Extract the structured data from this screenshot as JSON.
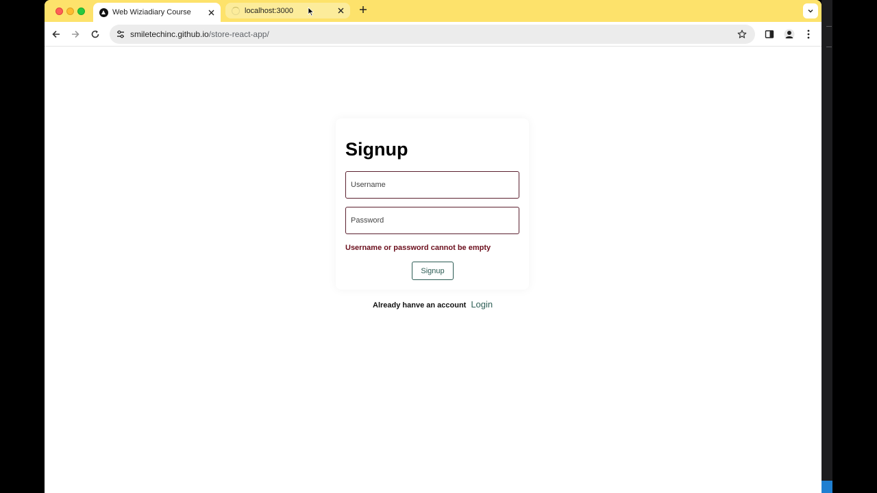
{
  "browser": {
    "tabs": [
      {
        "title": "Web Wiziadiary Course",
        "active": true,
        "favicon": "triangle-logo-icon"
      },
      {
        "title": "localhost:3000",
        "active": false,
        "favicon": "loading-spinner-icon"
      }
    ],
    "address": {
      "host": "smiletechinc.github.io",
      "path": "/store-react-app/"
    },
    "theme_color": "#fde26b"
  },
  "page": {
    "heading": "Signup",
    "username_placeholder": "Username",
    "password_placeholder": "Password",
    "error": "Username or password cannot be empty",
    "submit_label": "Signup",
    "account_prompt": "Already hanve an account",
    "login_link": "Login"
  },
  "colors": {
    "error": "#6b0e1c",
    "accent": "#2d5e55",
    "field_border": "#5a1f2e"
  }
}
